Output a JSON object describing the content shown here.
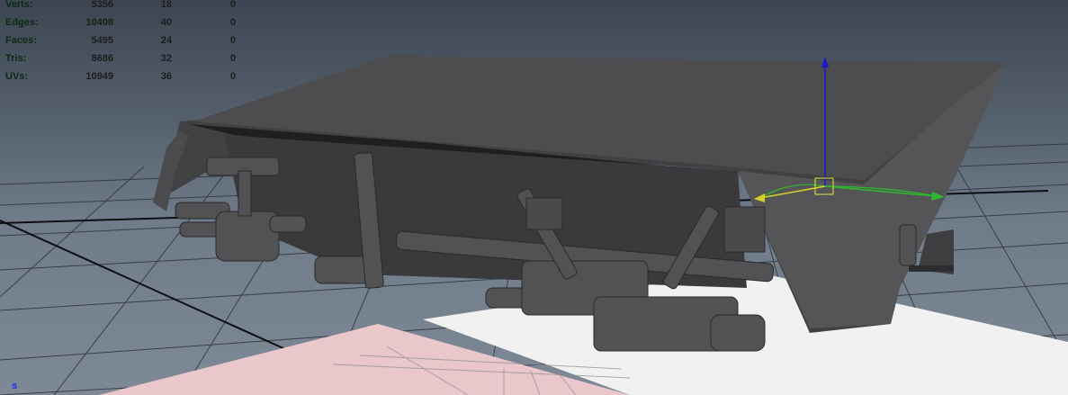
{
  "hud": {
    "rows": [
      {
        "label": "Verts:",
        "v1": "5356",
        "v2": "18",
        "v3": "0"
      },
      {
        "label": "Edges:",
        "v1": "10408",
        "v2": "40",
        "v3": "0"
      },
      {
        "label": "Faces:",
        "v1": "5495",
        "v2": "24",
        "v3": "0"
      },
      {
        "label": "Tris:",
        "v1": "8686",
        "v2": "32",
        "v3": "0"
      },
      {
        "label": "UVs:",
        "v1": "10949",
        "v2": "36",
        "v3": "0"
      }
    ]
  },
  "viewport": {
    "frame_label": "s"
  },
  "colors": {
    "grid": "#2b2f36",
    "axis_x": "#0d0f12",
    "model_dark": "#3f3f41",
    "model_mid": "#5a5a5c",
    "manip_y": "#1a1acc",
    "manip_x": "#2fb82f",
    "manip_z": "#d8d02a"
  }
}
